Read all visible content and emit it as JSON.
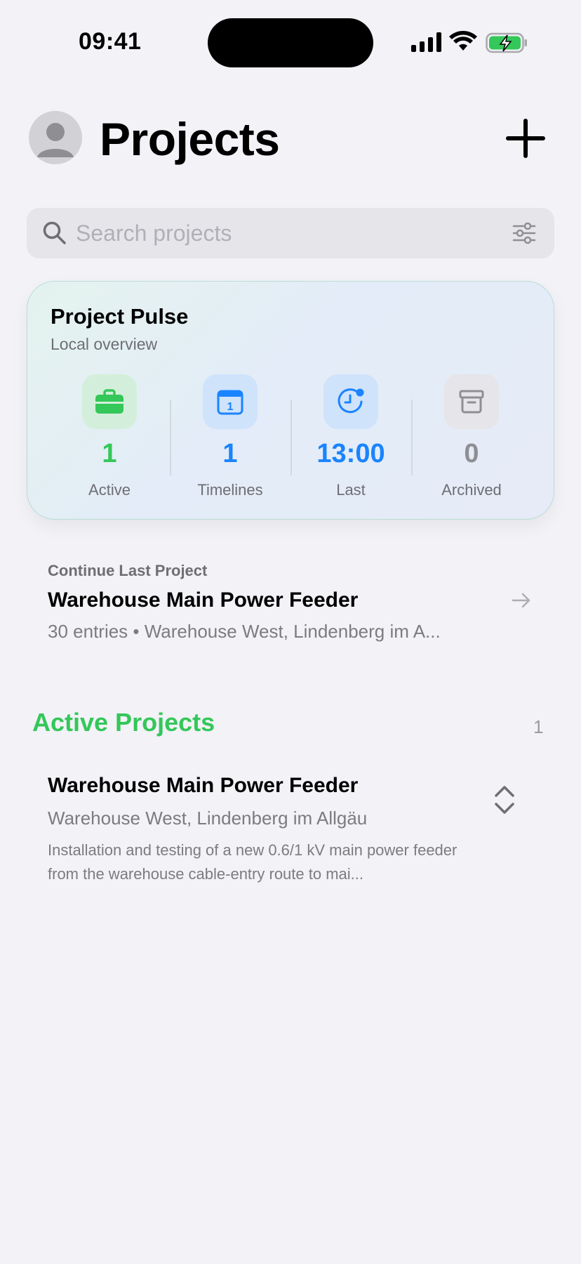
{
  "status_bar": {
    "time": "09:41"
  },
  "header": {
    "title": "Projects"
  },
  "search": {
    "placeholder": "Search projects"
  },
  "pulse": {
    "title": "Project Pulse",
    "subtitle": "Local overview",
    "stats": [
      {
        "value": "1",
        "label": "Active",
        "icon": "briefcase-icon",
        "color": "#34c759",
        "icon_bg": "#d3efdb"
      },
      {
        "value": "1",
        "label": "Timelines",
        "icon": "calendar-icon",
        "color": "#1a84ff",
        "icon_bg": "#cfe3fb"
      },
      {
        "value": "13:00",
        "label": "Last",
        "icon": "clock-badge-icon",
        "color": "#1a84ff",
        "icon_bg": "#cfe3fb"
      },
      {
        "value": "0",
        "label": "Archived",
        "icon": "archive-box-icon",
        "color": "#8e8e93",
        "icon_bg": "#e5e5ea"
      }
    ]
  },
  "continue": {
    "label": "Continue Last Project",
    "title": "Warehouse Main Power Feeder",
    "subtitle": "30 entries • Warehouse West, Lindenberg im A..."
  },
  "active_section": {
    "title": "Active Projects",
    "count": "1",
    "projects": [
      {
        "name": "Warehouse Main Power Feeder",
        "location": "Warehouse West, Lindenberg im Allgäu",
        "description": "Installation and testing of a new 0.6/1 kV main power feeder from the warehouse cable-entry route to mai..."
      }
    ]
  },
  "colors": {
    "accent_green": "#34c759",
    "accent_blue": "#1a84ff",
    "background": "#f2f2f7"
  }
}
